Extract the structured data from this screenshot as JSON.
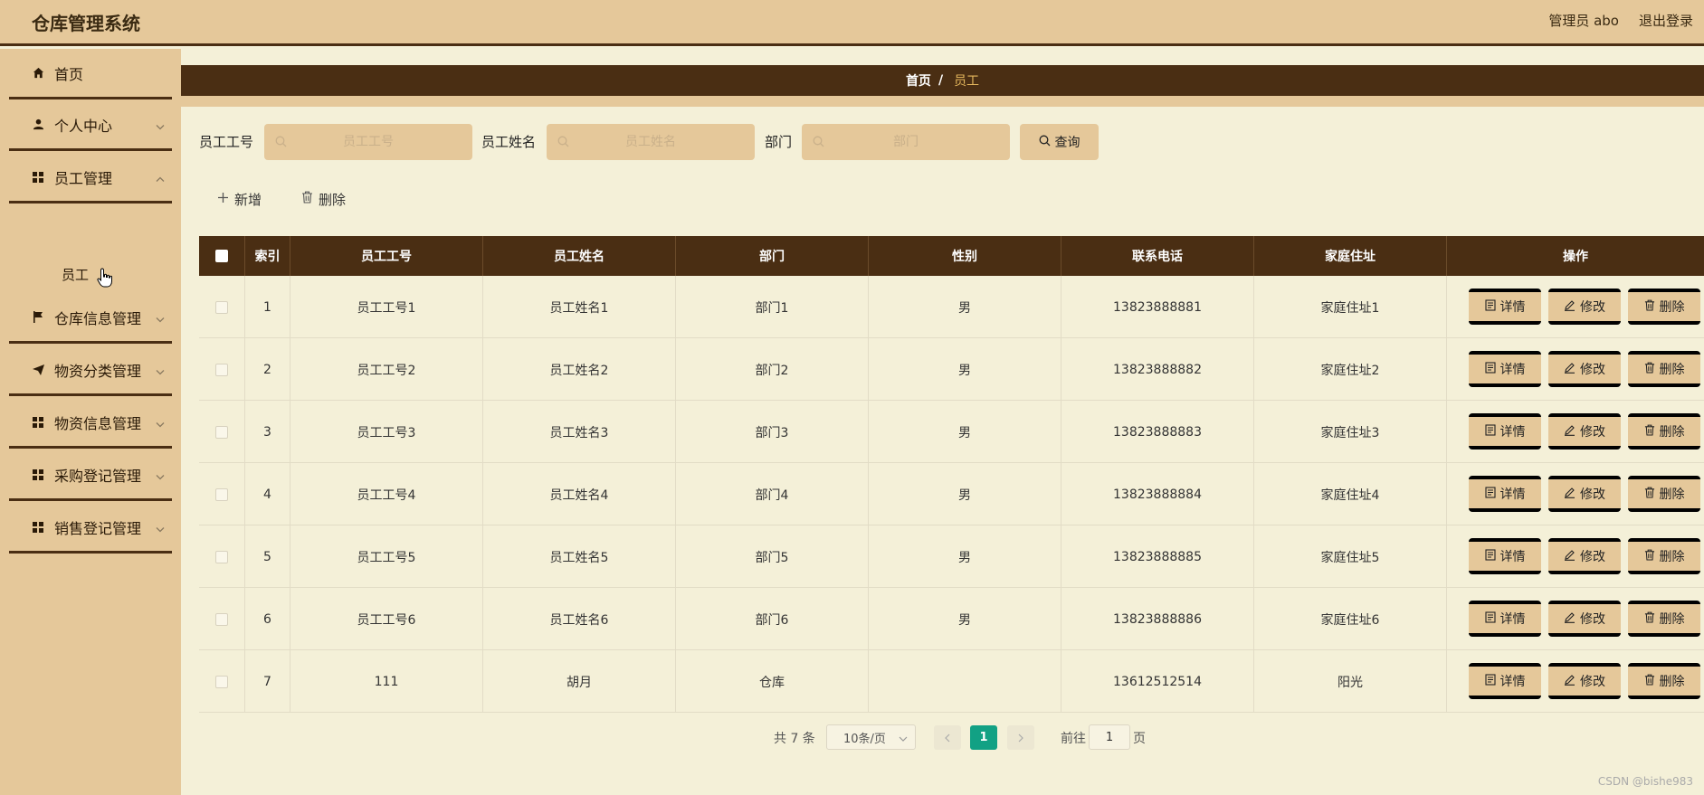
{
  "header": {
    "app_title": "仓库管理系统",
    "user_label": "管理员 abo",
    "logout_label": "退出登录"
  },
  "sidebar": {
    "items": [
      {
        "label": "首页",
        "icon": "home-icon"
      },
      {
        "label": "个人中心",
        "icon": "user-icon"
      },
      {
        "label": "员工管理",
        "icon": "grid-icon"
      },
      {
        "label": "仓库信息管理",
        "icon": "flag-icon"
      },
      {
        "label": "物资分类管理",
        "icon": "send-icon"
      },
      {
        "label": "物资信息管理",
        "icon": "grid-icon"
      },
      {
        "label": "采购登记管理",
        "icon": "grid-icon"
      },
      {
        "label": "销售登记管理",
        "icon": "grid-icon"
      }
    ],
    "sub_item": "员工"
  },
  "breadcrumb": {
    "home": "首页",
    "sep": "/",
    "current": "员工"
  },
  "search": {
    "emp_id_label": "员工工号",
    "emp_id_placeholder": "员工工号",
    "emp_name_label": "员工姓名",
    "emp_name_placeholder": "员工姓名",
    "dept_label": "部门",
    "dept_placeholder": "部门",
    "query_label": "查询"
  },
  "toolbar": {
    "add_label": "新增",
    "delete_label": "删除"
  },
  "table": {
    "headers": [
      "索引",
      "员工工号",
      "员工姓名",
      "部门",
      "性别",
      "联系电话",
      "家庭住址",
      "操作"
    ],
    "rows": [
      {
        "index": "1",
        "emp_id": "员工工号1",
        "name": "员工姓名1",
        "dept": "部门1",
        "gender": "男",
        "phone": "13823888881",
        "address": "家庭住址1"
      },
      {
        "index": "2",
        "emp_id": "员工工号2",
        "name": "员工姓名2",
        "dept": "部门2",
        "gender": "男",
        "phone": "13823888882",
        "address": "家庭住址2"
      },
      {
        "index": "3",
        "emp_id": "员工工号3",
        "name": "员工姓名3",
        "dept": "部门3",
        "gender": "男",
        "phone": "13823888883",
        "address": "家庭住址3"
      },
      {
        "index": "4",
        "emp_id": "员工工号4",
        "name": "员工姓名4",
        "dept": "部门4",
        "gender": "男",
        "phone": "13823888884",
        "address": "家庭住址4"
      },
      {
        "index": "5",
        "emp_id": "员工工号5",
        "name": "员工姓名5",
        "dept": "部门5",
        "gender": "男",
        "phone": "13823888885",
        "address": "家庭住址5"
      },
      {
        "index": "6",
        "emp_id": "员工工号6",
        "name": "员工姓名6",
        "dept": "部门6",
        "gender": "男",
        "phone": "13823888886",
        "address": "家庭住址6"
      },
      {
        "index": "7",
        "emp_id": "111",
        "name": "胡月",
        "dept": "仓库",
        "gender": "",
        "phone": "13612512514",
        "address": "阳光"
      }
    ],
    "actions": {
      "detail": "详情",
      "edit": "修改",
      "delete": "删除"
    }
  },
  "pagination": {
    "total_text": "共 7 条",
    "page_size": "10条/页",
    "current_page": "1",
    "goto_label": "前往",
    "goto_value": "1",
    "page_suffix": "页"
  },
  "watermark": "CSDN @bishe983",
  "colors": {
    "accent_brown": "#4a2e13",
    "tan": "#e5c89a",
    "background": "#f4f0d8",
    "page_active": "#12a184",
    "breadcrumb_current": "#e5b75d"
  }
}
